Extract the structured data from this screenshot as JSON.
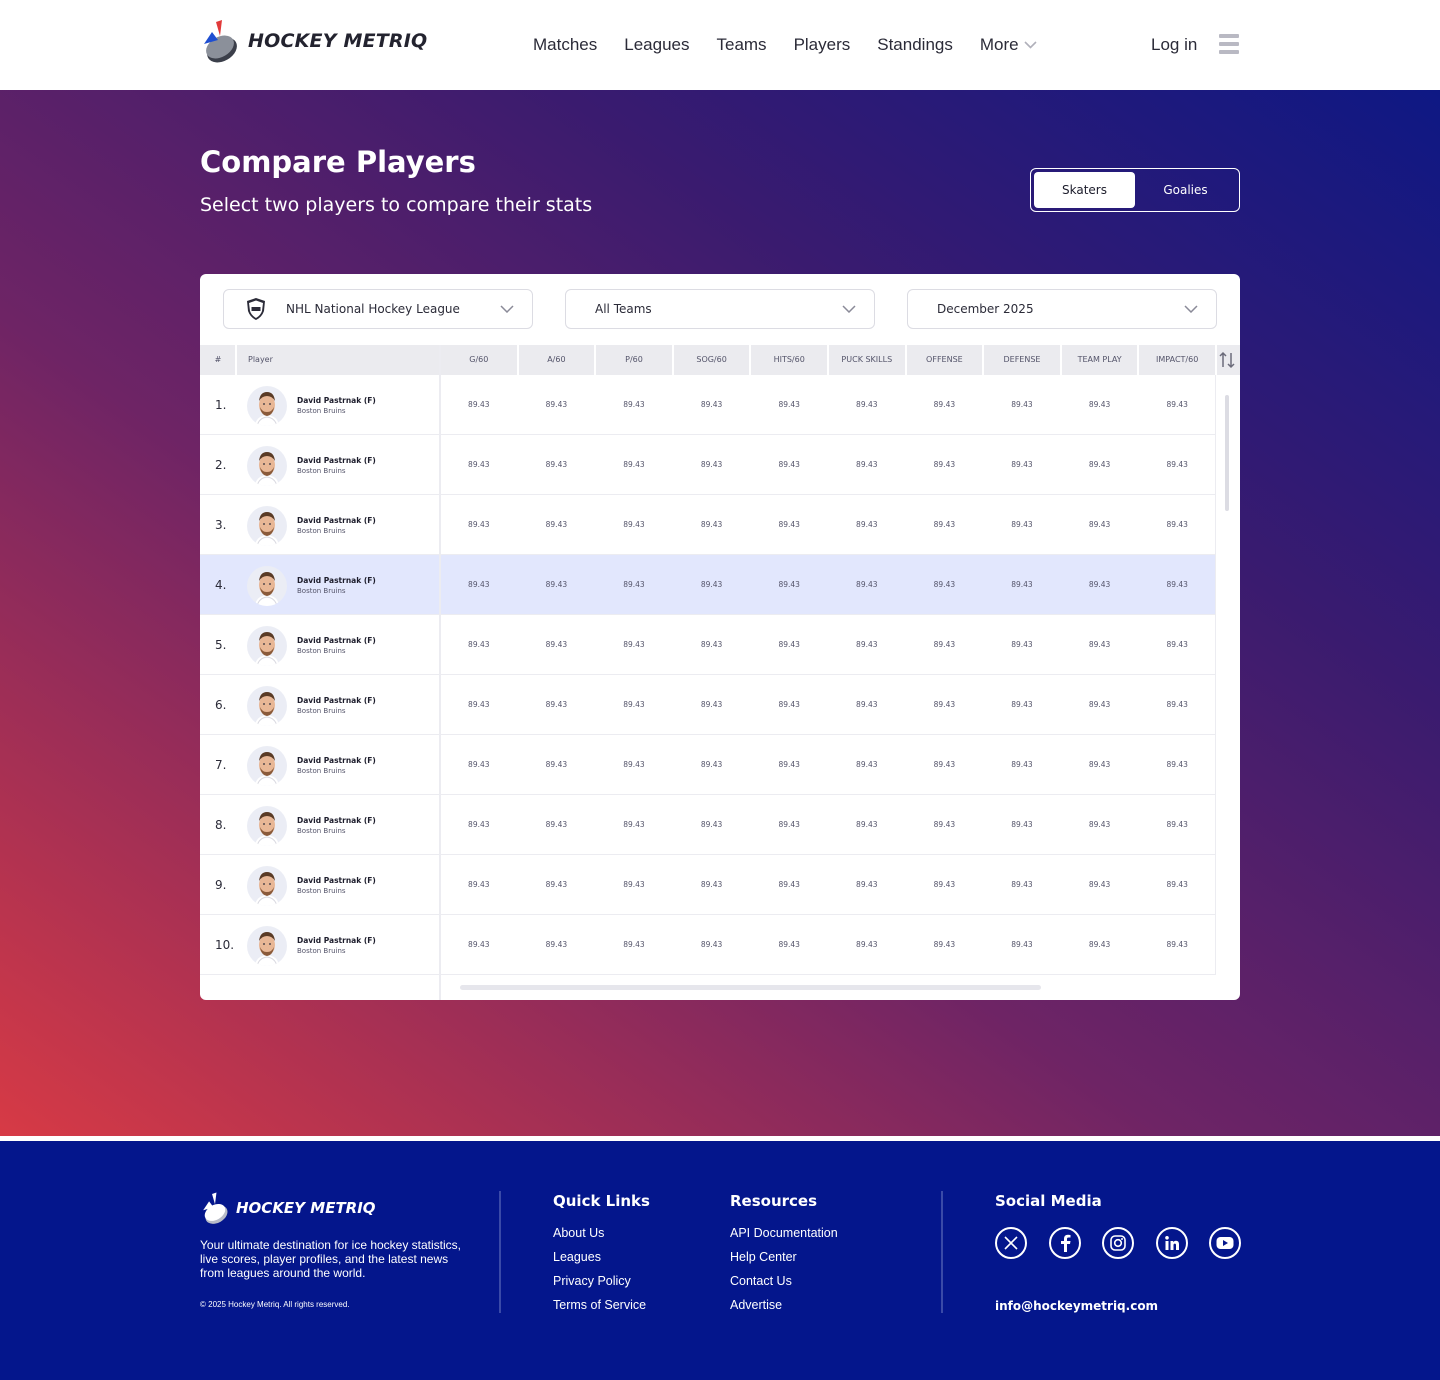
{
  "brand": {
    "name": "HOCKEY METRIQ"
  },
  "nav": {
    "items": [
      "Matches",
      "Leagues",
      "Teams",
      "Players",
      "Standings"
    ],
    "more_label": "More",
    "login_label": "Log in"
  },
  "hero": {
    "title": "Compare Players",
    "subtitle": "Select two players to compare their stats",
    "toggle": {
      "skaters": "Skaters",
      "goalies": "Goalies",
      "active": "Skaters"
    }
  },
  "filters": {
    "league": "NHL National Hockey League",
    "team": "All Teams",
    "date": "December 2025"
  },
  "table": {
    "columns": {
      "rank": "#",
      "player": "Player",
      "stats": [
        "G/60",
        "A/60",
        "P/60",
        "SOG/60",
        "HITS/60",
        "PUCK SKILLS",
        "OFFENSE",
        "DEFENSE",
        "TEAM PLAY",
        "IMPACT/60"
      ]
    },
    "highlighted_row": 4,
    "rows": [
      {
        "rank": "1.",
        "name": "David Pastrnak (F)",
        "team": "Boston Bruins",
        "stats": [
          "89.43",
          "89.43",
          "89.43",
          "89.43",
          "89.43",
          "89.43",
          "89.43",
          "89.43",
          "89.43",
          "89.43"
        ]
      },
      {
        "rank": "2.",
        "name": "David Pastrnak (F)",
        "team": "Boston Bruins",
        "stats": [
          "89.43",
          "89.43",
          "89.43",
          "89.43",
          "89.43",
          "89.43",
          "89.43",
          "89.43",
          "89.43",
          "89.43"
        ]
      },
      {
        "rank": "3.",
        "name": "David Pastrnak (F)",
        "team": "Boston Bruins",
        "stats": [
          "89.43",
          "89.43",
          "89.43",
          "89.43",
          "89.43",
          "89.43",
          "89.43",
          "89.43",
          "89.43",
          "89.43"
        ]
      },
      {
        "rank": "4.",
        "name": "David Pastrnak (F)",
        "team": "Boston Bruins",
        "stats": [
          "89.43",
          "89.43",
          "89.43",
          "89.43",
          "89.43",
          "89.43",
          "89.43",
          "89.43",
          "89.43",
          "89.43"
        ]
      },
      {
        "rank": "5.",
        "name": "David Pastrnak (F)",
        "team": "Boston Bruins",
        "stats": [
          "89.43",
          "89.43",
          "89.43",
          "89.43",
          "89.43",
          "89.43",
          "89.43",
          "89.43",
          "89.43",
          "89.43"
        ]
      },
      {
        "rank": "6.",
        "name": "David Pastrnak (F)",
        "team": "Boston Bruins",
        "stats": [
          "89.43",
          "89.43",
          "89.43",
          "89.43",
          "89.43",
          "89.43",
          "89.43",
          "89.43",
          "89.43",
          "89.43"
        ]
      },
      {
        "rank": "7.",
        "name": "David Pastrnak (F)",
        "team": "Boston Bruins",
        "stats": [
          "89.43",
          "89.43",
          "89.43",
          "89.43",
          "89.43",
          "89.43",
          "89.43",
          "89.43",
          "89.43",
          "89.43"
        ]
      },
      {
        "rank": "8.",
        "name": "David Pastrnak (F)",
        "team": "Boston Bruins",
        "stats": [
          "89.43",
          "89.43",
          "89.43",
          "89.43",
          "89.43",
          "89.43",
          "89.43",
          "89.43",
          "89.43",
          "89.43"
        ]
      },
      {
        "rank": "9.",
        "name": "David Pastrnak (F)",
        "team": "Boston Bruins",
        "stats": [
          "89.43",
          "89.43",
          "89.43",
          "89.43",
          "89.43",
          "89.43",
          "89.43",
          "89.43",
          "89.43",
          "89.43"
        ]
      },
      {
        "rank": "10.",
        "name": "David Pastrnak (F)",
        "team": "Boston Bruins",
        "stats": [
          "89.43",
          "89.43",
          "89.43",
          "89.43",
          "89.43",
          "89.43",
          "89.43",
          "89.43",
          "89.43",
          "89.43"
        ]
      }
    ]
  },
  "footer": {
    "brand": "HOCKEY METRIQ",
    "description": "Your ultimate destination for ice hockey statistics, live scores, player profiles, and the latest news from leagues around the world.",
    "copyright": "© 2025 Hockey Metriq. All rights reserved.",
    "quick_links": {
      "title": "Quick Links",
      "items": [
        "About Us",
        "Leagues",
        "Privacy Policy",
        "Terms of Service"
      ]
    },
    "resources": {
      "title": "Resources",
      "items": [
        "API Documentation",
        "Help Center",
        "Contact Us",
        "Advertise"
      ]
    },
    "social": {
      "title": "Social Media",
      "icons": [
        "x-icon",
        "facebook-icon",
        "instagram-icon",
        "linkedin-icon",
        "youtube-icon"
      ]
    },
    "email": "info@hockeymetriq.com"
  },
  "colors": {
    "footer_bg": "#04168c",
    "highlight_row": "#e2e7fd",
    "gradient": [
      "#0e1884",
      "#3a1b6f",
      "#6e2465",
      "#d73a45"
    ]
  }
}
